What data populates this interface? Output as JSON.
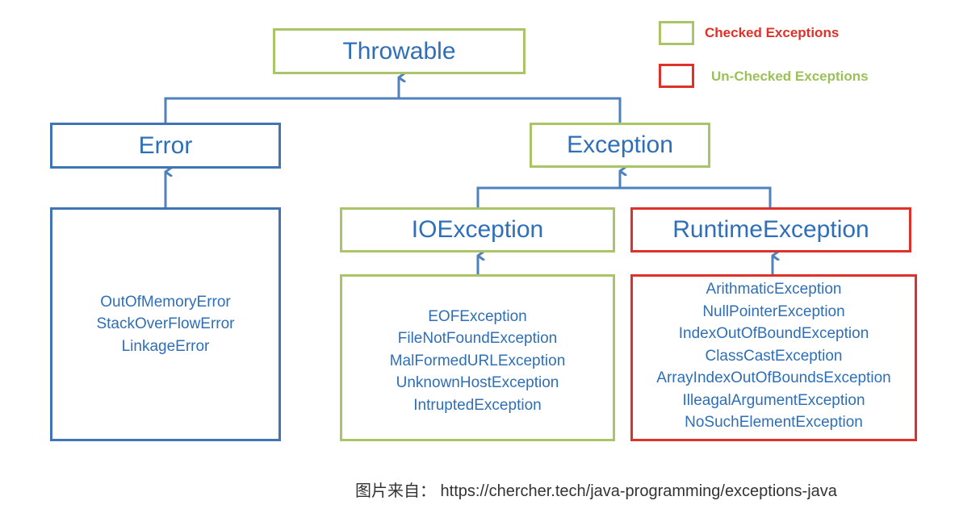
{
  "legend": [
    {
      "label": "Checked Exceptions",
      "swatch_color": "#a9c567",
      "label_color": "#e0302a"
    },
    {
      "label": "Un-Checked Exceptions",
      "swatch_color": "#e0302a",
      "label_color": "#9bc15a"
    }
  ],
  "nodes": {
    "throwable": {
      "title": "Throwable",
      "kind": "checked"
    },
    "error": {
      "title": "Error",
      "kind": "error"
    },
    "exception": {
      "title": "Exception",
      "kind": "checked"
    },
    "ioexception": {
      "title": "IOException",
      "kind": "checked"
    },
    "runtimeexception": {
      "title": "RuntimeException",
      "kind": "unchecked"
    }
  },
  "lists": {
    "error_subtypes": [
      "OutOfMemoryError",
      "StackOverFlowError",
      "LinkageError"
    ],
    "ioexception_subtypes": [
      "EOFException",
      "FileNotFoundException",
      "MalFormedURLException",
      "UnknownHostException",
      "IntruptedException"
    ],
    "runtime_subtypes": [
      "ArithmaticException",
      "NullPointerException",
      "IndexOutOfBoundException",
      "ClassCastException",
      "ArrayIndexOutOfBoundsException",
      "IlleagalArgumentException",
      "NoSuchElementException"
    ]
  },
  "edges": [
    {
      "from": "error",
      "to": "throwable"
    },
    {
      "from": "exception",
      "to": "throwable"
    },
    {
      "from": "ioexception",
      "to": "exception"
    },
    {
      "from": "runtimeexception",
      "to": "exception"
    },
    {
      "from": "error_subtypes",
      "to": "error"
    },
    {
      "from": "ioexception_subtypes",
      "to": "ioexception"
    },
    {
      "from": "runtime_subtypes",
      "to": "runtimeexception"
    }
  ],
  "colors": {
    "connector": "#4f81bd",
    "text": "#2e6fb7"
  },
  "source_caption": "图片来自： https://chercher.tech/java-programming/exceptions-java"
}
